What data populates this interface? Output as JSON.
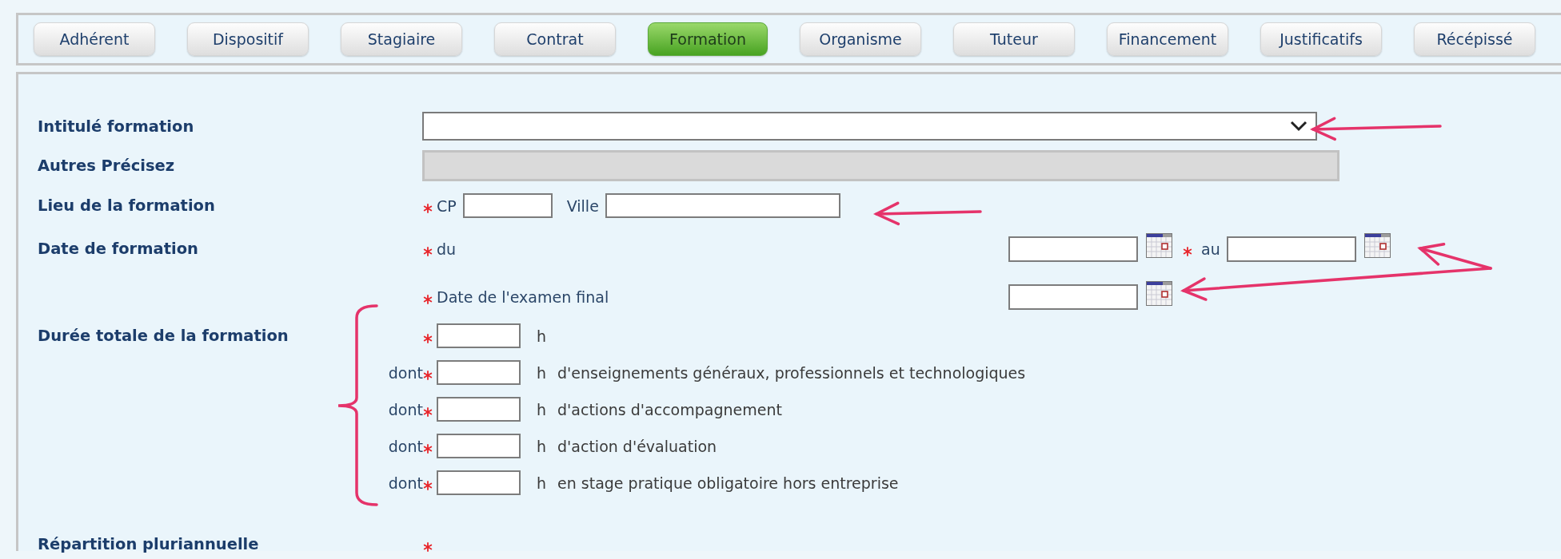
{
  "tabs": [
    {
      "label": "Adhérent",
      "selected": false
    },
    {
      "label": "Dispositif",
      "selected": false
    },
    {
      "label": "Stagiaire",
      "selected": false
    },
    {
      "label": "Contrat",
      "selected": false
    },
    {
      "label": "Formation",
      "selected": true
    },
    {
      "label": "Organisme",
      "selected": false
    },
    {
      "label": "Tuteur",
      "selected": false
    },
    {
      "label": "Financement",
      "selected": false
    },
    {
      "label": "Justificatifs",
      "selected": false
    },
    {
      "label": "Récépissé",
      "selected": false
    }
  ],
  "form": {
    "training_title": {
      "label": "Intitulé formation"
    },
    "other": {
      "label": "Autres Précisez",
      "disabled": true
    },
    "location": {
      "label": "Lieu de la formation",
      "required": true,
      "postcode_label": "CP",
      "city_label": "Ville"
    },
    "dates": {
      "label": "Date de formation",
      "required": true,
      "from_label": "du",
      "to_label": "au",
      "exam_label": "Date de l'examen final"
    },
    "duration": {
      "label": "Durée totale de la formation",
      "required": true,
      "unit": "h",
      "details": [
        {
          "prefix": "dont",
          "required": true,
          "unit": "h",
          "text": "d'enseignements généraux, professionnels et technologiques"
        },
        {
          "prefix": "dont",
          "required": true,
          "unit": "h",
          "text": "d'actions d'accompagnement"
        },
        {
          "prefix": "dont",
          "required": true,
          "unit": "h",
          "text": "d'action d'évaluation"
        },
        {
          "prefix": "dont",
          "required": true,
          "unit": "h",
          "text": "en stage pratique obligatoire hors entreprise"
        }
      ]
    },
    "multi_year": {
      "label": "Répartition pluriannuelle",
      "required": true
    }
  }
}
